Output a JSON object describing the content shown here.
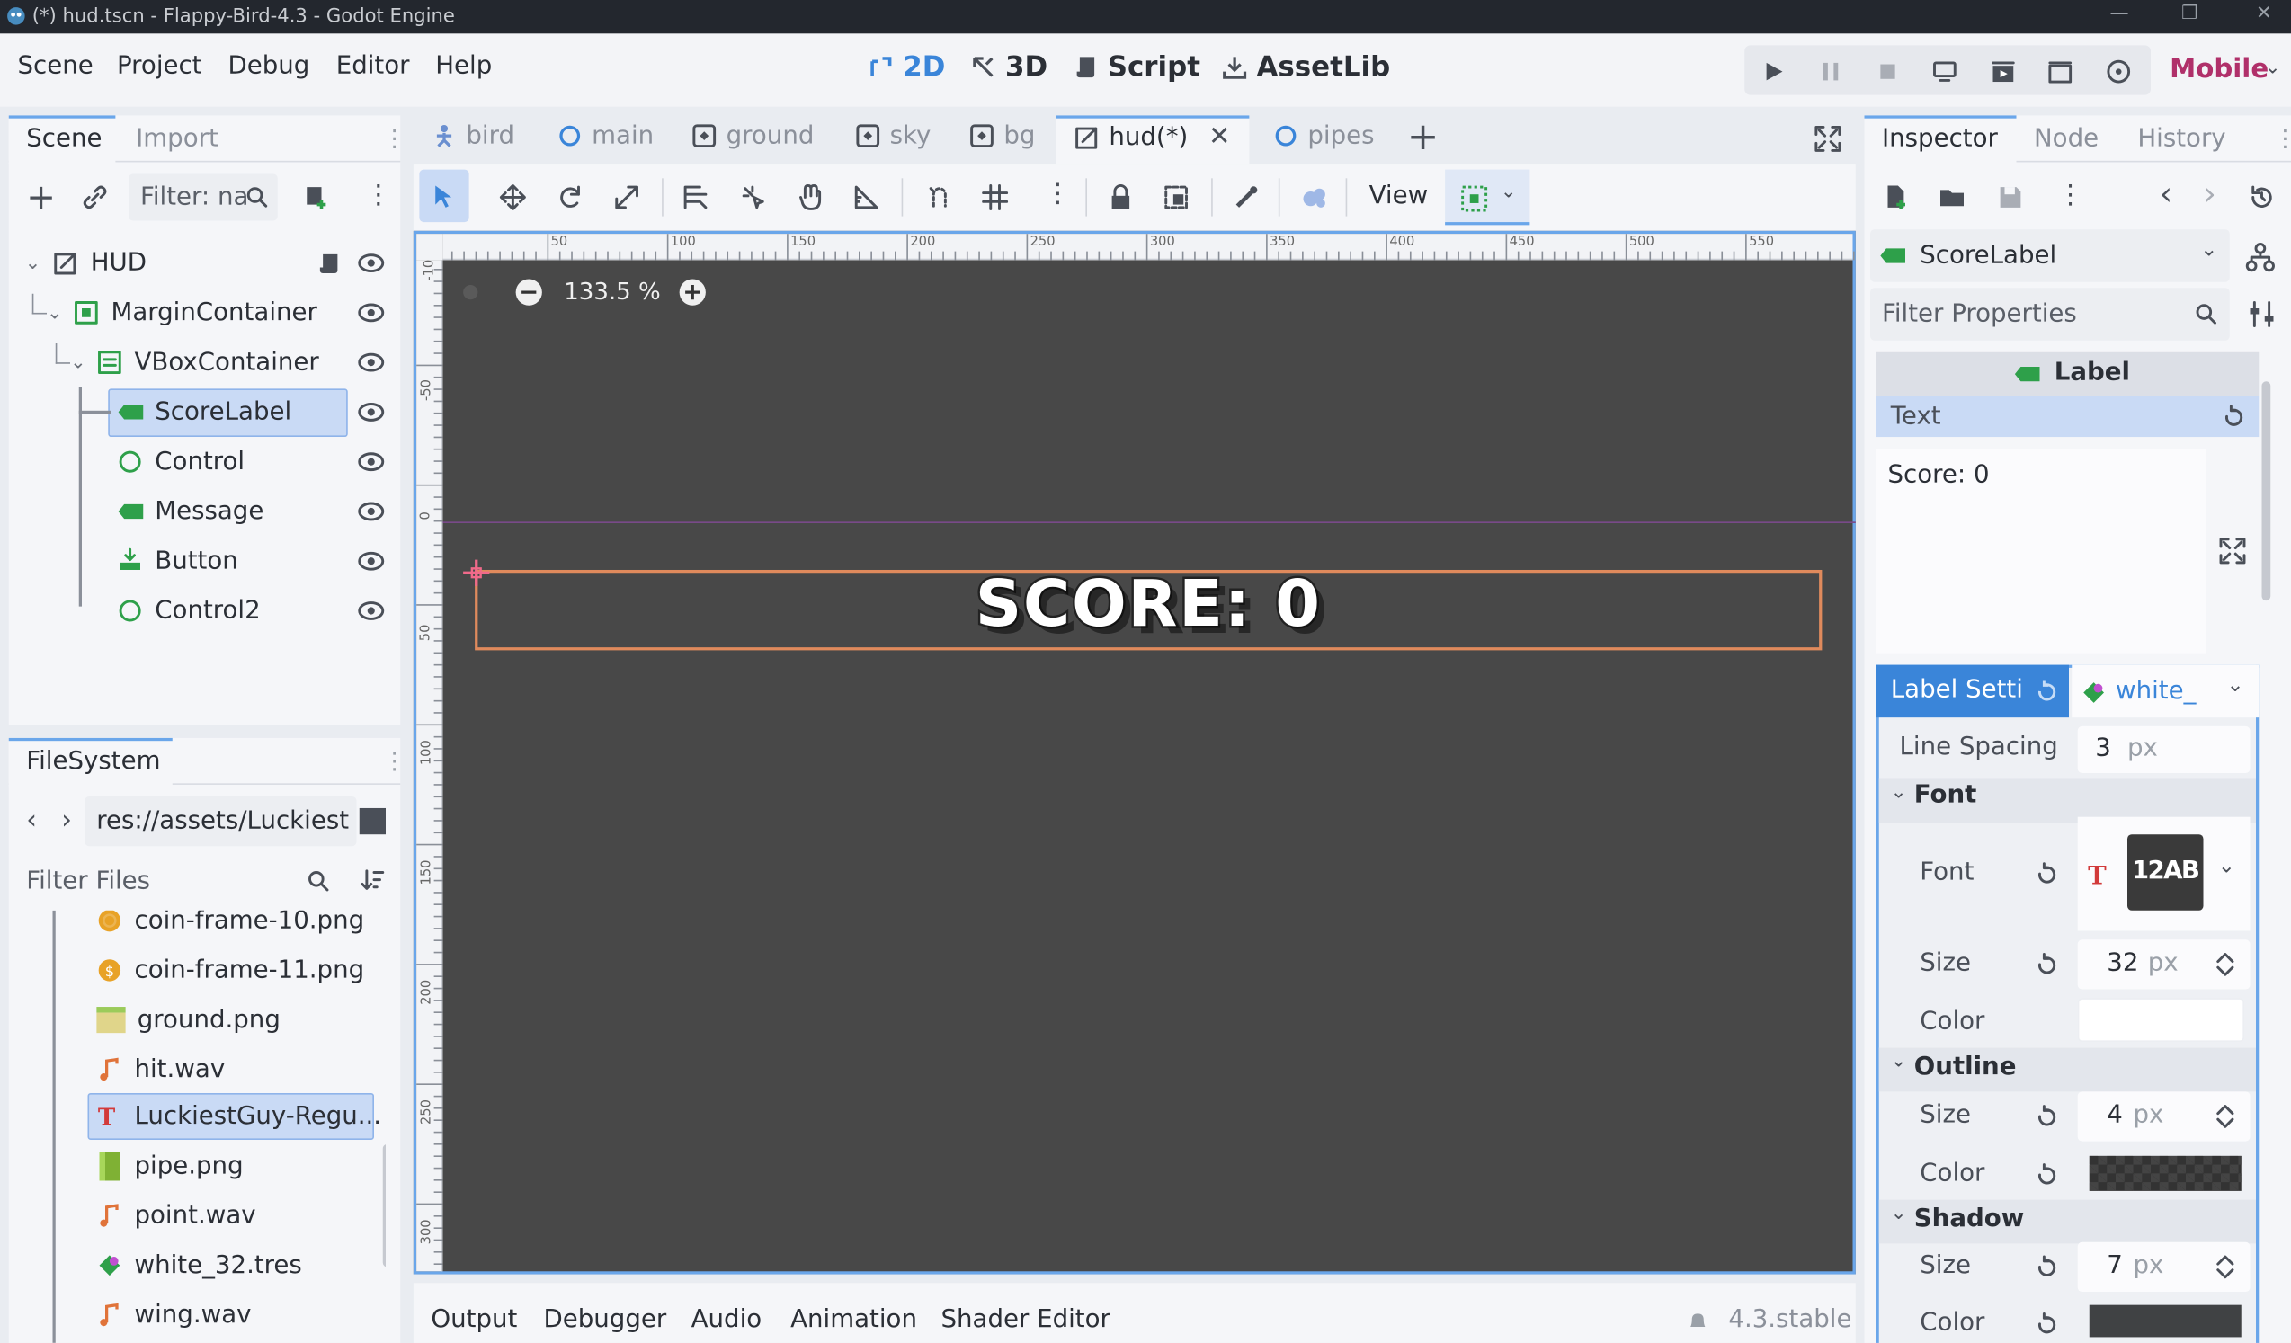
{
  "window": {
    "title": "(*) hud.tscn - Flappy-Bird-4.3 - Godot Engine"
  },
  "menu": [
    "Scene",
    "Project",
    "Debug",
    "Editor",
    "Help"
  ],
  "workspaces": {
    "2d": "2D",
    "3d": "3D",
    "script": "Script",
    "assetlib": "AssetLib"
  },
  "renderer": "Mobile",
  "scene_panel": {
    "tabs": [
      "Scene",
      "Import"
    ],
    "filter_placeholder": "Filter: na",
    "nodes": [
      {
        "name": "HUD"
      },
      {
        "name": "MarginContainer"
      },
      {
        "name": "VBoxContainer"
      },
      {
        "name": "ScoreLabel"
      },
      {
        "name": "Control"
      },
      {
        "name": "Message"
      },
      {
        "name": "Button"
      },
      {
        "name": "Control2"
      }
    ]
  },
  "filesystem": {
    "title": "FileSystem",
    "path": "res://assets/Luckiest",
    "filter_placeholder": "Filter Files",
    "files": [
      "coin-frame-10.png",
      "coin-frame-11.png",
      "ground.png",
      "hit.wav",
      "LuckiestGuy-Regu...",
      "pipe.png",
      "point.wav",
      "white_32.tres",
      "wing.wav"
    ]
  },
  "scene_tabs": [
    "bird",
    "main",
    "ground",
    "sky",
    "bg",
    "hud(*)",
    "pipes"
  ],
  "toolbar": {
    "view_label": "View"
  },
  "viewport": {
    "zoom": "133.5 %",
    "label_text": "SCORE: 0",
    "ruler_h": [
      "50",
      "100",
      "150",
      "200",
      "250",
      "300",
      "350",
      "400",
      "450",
      "500",
      "550"
    ],
    "ruler_v": [
      "0",
      "50",
      "100",
      "150",
      "200",
      "250",
      "300",
      "-50",
      "-10"
    ]
  },
  "bottom_panel": {
    "tabs": [
      "Output",
      "Debugger",
      "Audio",
      "Animation",
      "Shader Editor"
    ],
    "version": "4.3.stable"
  },
  "inspector": {
    "tabs": [
      "Inspector",
      "Node",
      "History"
    ],
    "node_name": "ScoreLabel",
    "filter_placeholder": "Filter Properties",
    "class_header": "Label",
    "text_label": "Text",
    "text_value": "Score: 0",
    "label_settings": "Label Setti",
    "settings_resource": "white_",
    "line_spacing": {
      "label": "Line Spacing",
      "value": "3",
      "unit": "px"
    },
    "font_section": "Font",
    "font": {
      "label": "Font",
      "preview": "12AB"
    },
    "font_size": {
      "label": "Size",
      "value": "32",
      "unit": "px"
    },
    "font_color": {
      "label": "Color"
    },
    "outline_section": "Outline",
    "outline_size": {
      "label": "Size",
      "value": "4",
      "unit": "px"
    },
    "outline_color": {
      "label": "Color"
    },
    "shadow_section": "Shadow",
    "shadow_size": {
      "label": "Size",
      "value": "7",
      "unit": "px"
    },
    "shadow_color": {
      "label": "Color"
    }
  },
  "colors": {
    "accent": "#3a85d9",
    "node_green": "#2ea04a",
    "viewport_bg": "#484848",
    "selection_rect": "#e08a5c"
  }
}
